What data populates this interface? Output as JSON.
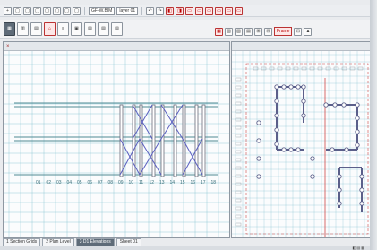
{
  "toolbar_top": {
    "buttons": [
      "+",
      "◯",
      "◯",
      "◯",
      "◯",
      "◯",
      "◯",
      "◯"
    ],
    "dropdown_a": "GF-W.BIM",
    "dropdown_b": "layer 01",
    "extra_buttons": [
      "↶",
      "↷",
      "◧",
      "◨",
      "▭",
      "▭",
      "▭",
      "▭",
      "▭",
      "▭"
    ]
  },
  "toolbar_second": {
    "buttons": [
      "▦",
      "▥",
      "▤",
      "⌂",
      "≡",
      "▣",
      "▤",
      "▤",
      "▤"
    ],
    "right_buttons": [
      "▦",
      "▧",
      "▨",
      "▤",
      "⊞",
      "⊟"
    ],
    "scale_label": "Frame",
    "right_icons": [
      "⊡",
      "▲"
    ]
  },
  "left_panel": {
    "title": "",
    "bay_labels": [
      "01",
      "02",
      "03",
      "04",
      "05",
      "06",
      "07",
      "08",
      "09",
      "10",
      "11",
      "12",
      "13",
      "14",
      "15",
      "16",
      "17",
      "18"
    ]
  },
  "right_panel": {
    "title": ""
  },
  "tabs": [
    "1 Section Grids",
    "2 Plan Level",
    "3 D1 Elevations",
    "Sheet 01"
  ],
  "active_tab_index": 2,
  "status": {
    "left": "",
    "right": "◧ ▤ ▦"
  },
  "colors": {
    "grid_cyan": "#6fb8c8",
    "brace_blue": "#5a5fc0",
    "column_gray": "#6d6d7a",
    "beam_teal": "#4f8a94",
    "plan_node": "#5b5f8a",
    "red_line": "#d04848"
  }
}
